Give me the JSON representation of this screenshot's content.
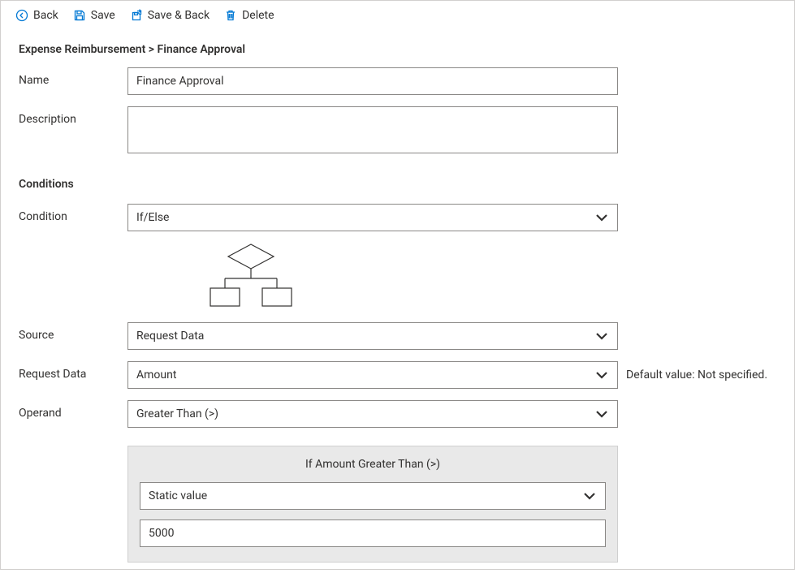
{
  "toolbar": {
    "back": "Back",
    "save": "Save",
    "saveBack": "Save & Back",
    "delete": "Delete"
  },
  "breadcrumb": {
    "parent": "Expense Reimbursement",
    "separator": " > ",
    "current": "Finance Approval"
  },
  "form": {
    "nameLabel": "Name",
    "nameValue": "Finance Approval",
    "descriptionLabel": "Description",
    "descriptionValue": ""
  },
  "conditionsHeading": "Conditions",
  "conditionRow": {
    "label": "Condition",
    "value": "If/Else"
  },
  "sourceRow": {
    "label": "Source",
    "value": "Request Data"
  },
  "requestDataRow": {
    "label": "Request Data",
    "value": "Amount",
    "hint": "Default value: Not specified."
  },
  "operandRow": {
    "label": "Operand",
    "value": "Greater Than (>)"
  },
  "ifBox": {
    "title": "If Amount Greater Than (>)",
    "valueTypeSelected": "Static value",
    "staticValue": "5000"
  }
}
